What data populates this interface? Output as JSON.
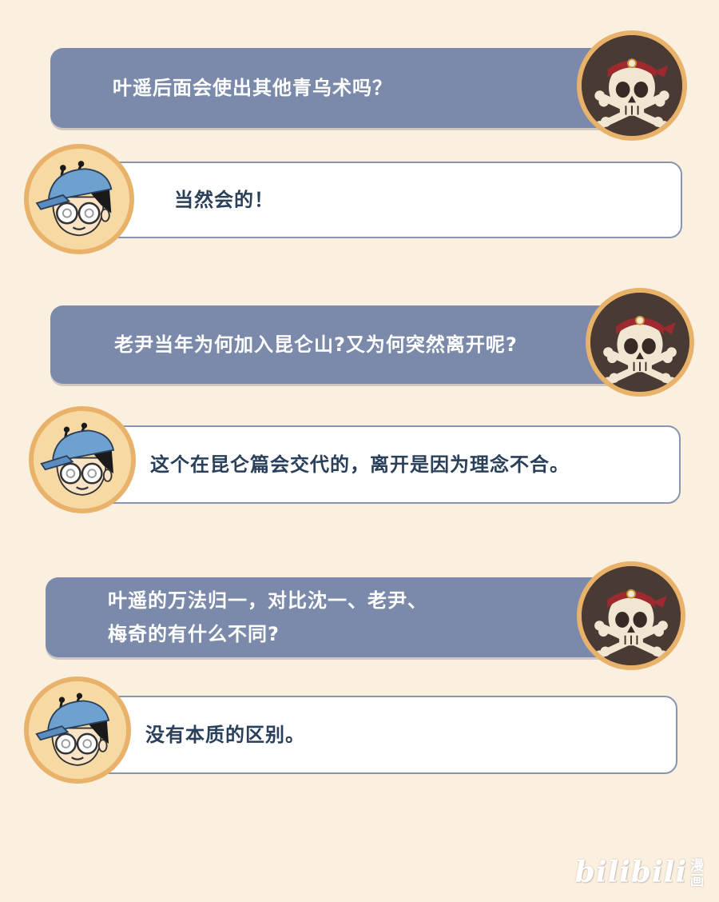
{
  "dialog": [
    {
      "role": "question",
      "text": "叶遥后面会使出其他青乌术吗？"
    },
    {
      "role": "answer",
      "text": "当然会的！"
    },
    {
      "role": "question",
      "text": "老尹当年为何加入昆仑山?又为何突然离开呢?"
    },
    {
      "role": "answer",
      "text": "这个在昆仑篇会交代的，离开是因为理念不合。"
    },
    {
      "role": "question",
      "lines": [
        "叶遥的万法归一，对比沈一、老尹、",
        "梅奇的有什么不同?"
      ]
    },
    {
      "role": "answer",
      "text": "没有本质的区别。"
    }
  ],
  "avatars": {
    "question_icon": "skull-pirate-icon",
    "answer_icon": "boy-glasses-cap-icon"
  },
  "watermark": {
    "logo": "bilibili",
    "label": "漫画"
  },
  "colors": {
    "background": "#fbf0df",
    "question_bubble": "#7b8aaa",
    "answer_text": "#2a3f5a",
    "avatar_ring": "#e9b26a"
  }
}
